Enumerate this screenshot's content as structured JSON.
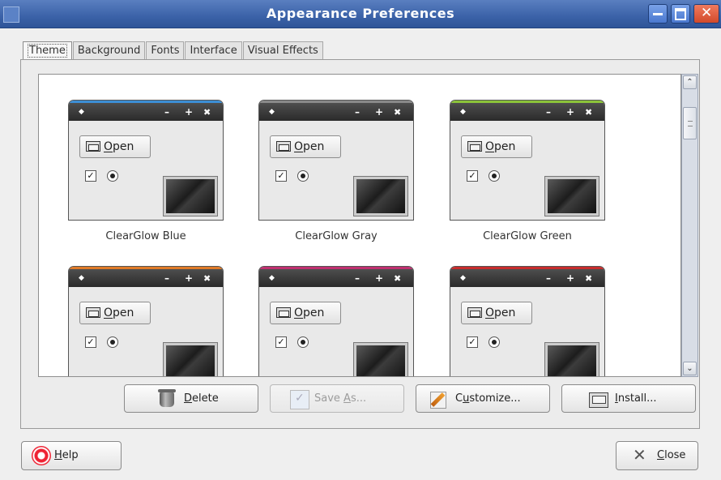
{
  "window": {
    "title": "Appearance Preferences",
    "accent_color": "#3b62a8"
  },
  "tabs": [
    {
      "label": "Theme",
      "active": true
    },
    {
      "label": "Background",
      "active": false
    },
    {
      "label": "Fonts",
      "active": false
    },
    {
      "label": "Interface",
      "active": false
    },
    {
      "label": "Visual Effects",
      "active": false
    }
  ],
  "theme_preview": {
    "open_label": "Open",
    "open_mnemonic": "O",
    "open_rest": "pen",
    "dot_glyph": "◆",
    "min_glyph": "–",
    "max_glyph": "+",
    "close_glyph": "✖",
    "check_glyph": "✓"
  },
  "themes": [
    {
      "name": "ClearGlow Blue",
      "color": "#3d8fd6"
    },
    {
      "name": "ClearGlow Gray",
      "color": "#8a8a8a"
    },
    {
      "name": "ClearGlow Green",
      "color": "#8cc43a"
    },
    {
      "name": "",
      "color": "#e07a28"
    },
    {
      "name": "",
      "color": "#c03070"
    },
    {
      "name": "",
      "color": "#c82c2c"
    }
  ],
  "actions": {
    "delete": {
      "mnemonic": "D",
      "rest": "elete"
    },
    "save_as": {
      "pre": "Save ",
      "mnemonic": "A",
      "rest": "s..."
    },
    "customize": {
      "pre": "C",
      "mnemonic": "u",
      "rest": "stomize..."
    },
    "install": {
      "mnemonic": "I",
      "rest": "nstall..."
    }
  },
  "footer": {
    "help": {
      "mnemonic": "H",
      "rest": "elp"
    },
    "close": {
      "mnemonic": "C",
      "rest": "lose"
    }
  },
  "scrollbar": {
    "up_glyph": "⌃",
    "down_glyph": "⌄"
  }
}
